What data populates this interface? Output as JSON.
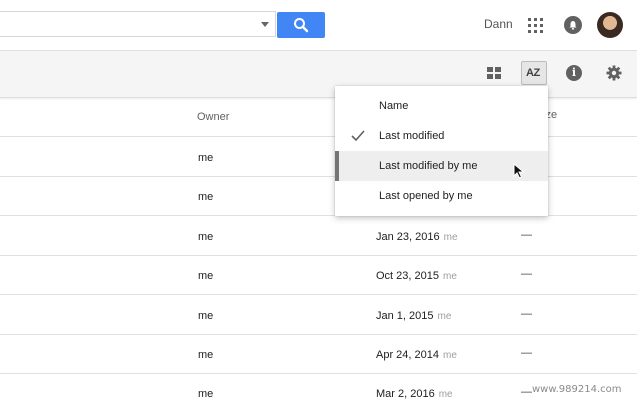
{
  "header": {
    "user_name": "Dann",
    "icons": [
      "search-icon",
      "dropdown-arrow-icon",
      "apps-grid-icon",
      "notifications-icon",
      "avatar"
    ]
  },
  "toolbar": {
    "sort_label": "AZ",
    "icons": [
      "grid-view-icon",
      "sort-az-icon",
      "info-icon",
      "settings-gear-icon"
    ]
  },
  "list": {
    "columns": {
      "owner": "Owner",
      "size": "ize"
    },
    "rows": [
      {
        "owner": "me",
        "modified": "",
        "by": "",
        "size": ""
      },
      {
        "owner": "me",
        "modified": "",
        "by": "",
        "size": ""
      },
      {
        "owner": "me",
        "modified": "Jan 23, 2016",
        "by": "me",
        "size": "—"
      },
      {
        "owner": "me",
        "modified": "Oct 23, 2015",
        "by": "me",
        "size": "—"
      },
      {
        "owner": "me",
        "modified": "Jan 1, 2015",
        "by": "me",
        "size": "—"
      },
      {
        "owner": "me",
        "modified": "Apr 24, 2014",
        "by": "me",
        "size": "—"
      },
      {
        "owner": "me",
        "modified": "Mar 2, 2016",
        "by": "me",
        "size": "—"
      }
    ]
  },
  "sort_menu": {
    "items": [
      {
        "label": "Name",
        "checked": false,
        "hovered": false
      },
      {
        "label": "Last modified",
        "checked": true,
        "hovered": false
      },
      {
        "label": "Last modified by me",
        "checked": false,
        "hovered": true
      },
      {
        "label": "Last opened by me",
        "checked": false,
        "hovered": false
      }
    ]
  },
  "watermark": "www.989214.com",
  "colors": {
    "accent_blue": "#4285f4",
    "icon_gray": "#616161",
    "toolbar_bg": "#f5f5f5",
    "menu_hover": "#eeeeee"
  }
}
